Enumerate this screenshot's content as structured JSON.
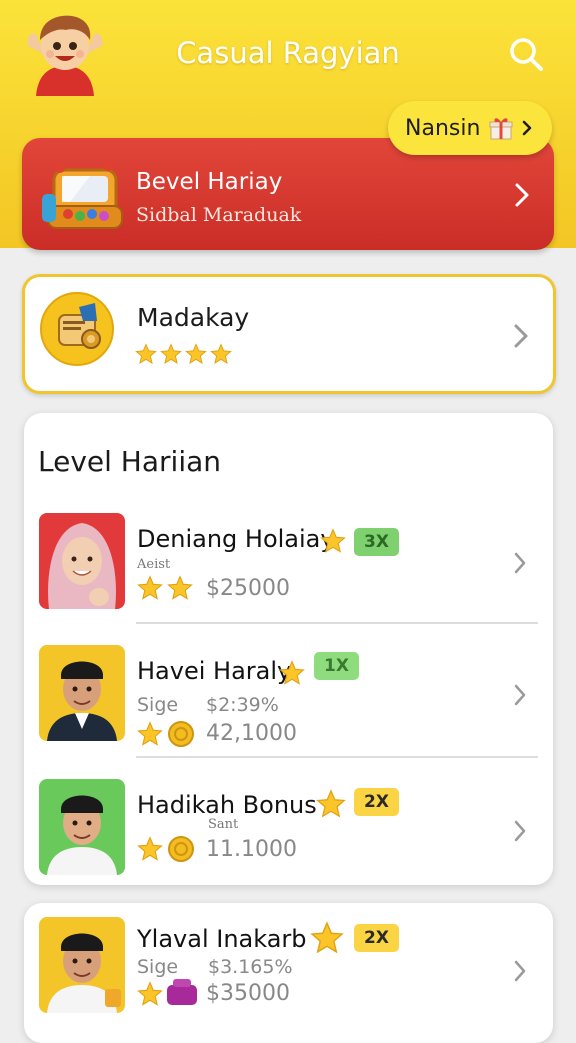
{
  "header": {
    "title": "Casual Ragyian",
    "avatar_icon": "cartoon-boy-avatar-icon",
    "search_icon": "search-icon",
    "background_colors": [
      "#fbe33a",
      "#f3c624"
    ]
  },
  "promo_pill": {
    "label": "Nansin",
    "icon": "gift-icon",
    "chevron": "chevron-right-icon"
  },
  "daily_card": {
    "title": "Bevel Hariay",
    "subtitle": "Sidbal Maraduak",
    "icon": "game-console-icon",
    "color": "#d63a30"
  },
  "feature_card": {
    "title": "Madakay",
    "stars": 4,
    "icon": "scroll-coin-icon",
    "border_color": "#f0c52e"
  },
  "level_list": {
    "title": "Level Hariian",
    "items": [
      {
        "name": "Deniang Holaiay",
        "badge": "3X",
        "badge_color": "green",
        "sub_label": "Aeist",
        "stars": 2,
        "amount": "$25000",
        "photo_bg": "#e23a3a"
      },
      {
        "name": "Havei Haraly",
        "badge": "1X",
        "badge_color": "lgreen",
        "sub_label": "Sige",
        "sub_value": "$2:39%",
        "amount": "42,1000",
        "photo_bg": "#f4c528"
      },
      {
        "name": "Hadikah Bonus",
        "badge": "2X",
        "badge_color": "yellow",
        "sub_label": "Sant",
        "amount": "11.1000",
        "photo_bg": "#69c95a"
      }
    ]
  },
  "bottom_item": {
    "name": "Ylaval Inakarb",
    "badge": "2X",
    "sub_label": "Sige",
    "sub_value": "$3.165%",
    "amount": "$35000",
    "photo_bg": "#f4c528"
  }
}
